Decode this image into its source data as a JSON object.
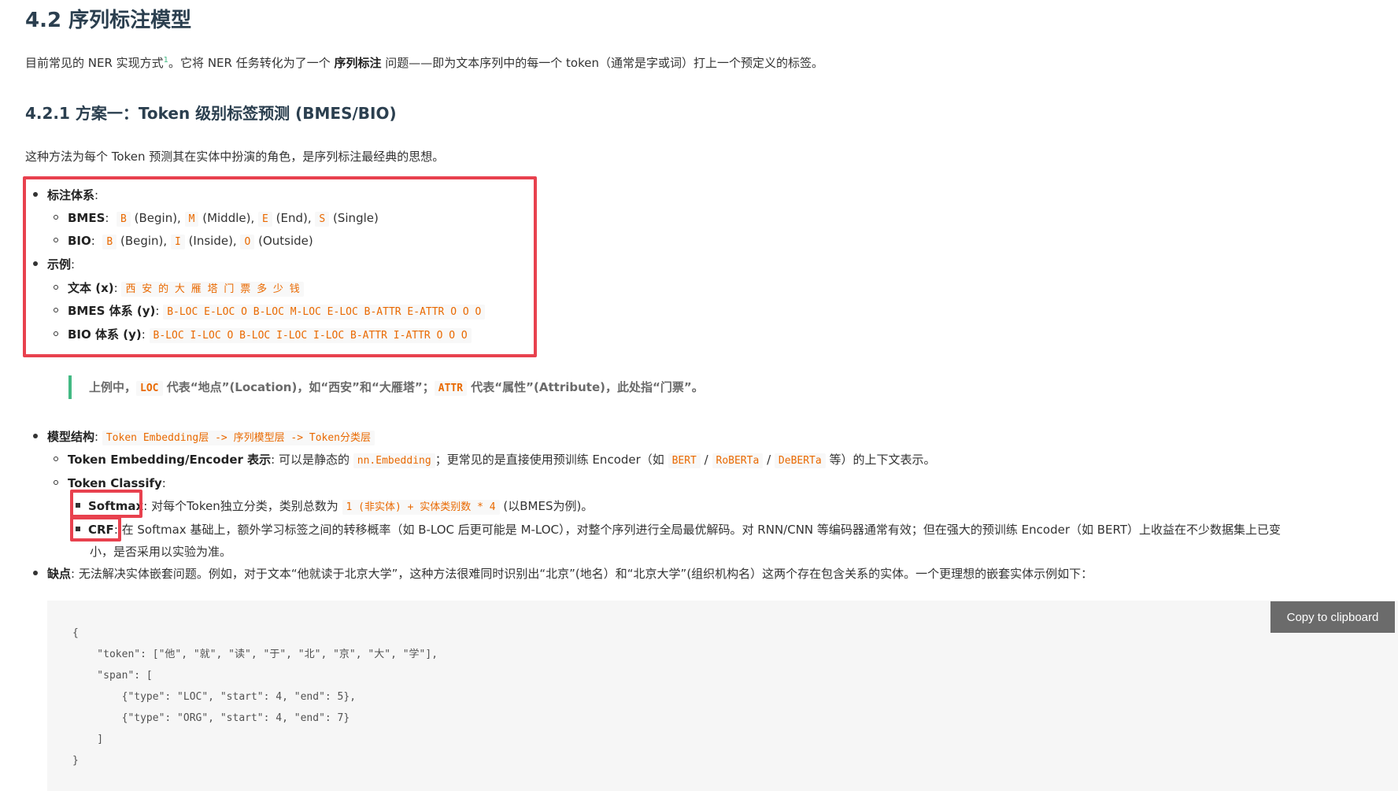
{
  "heading": "4.2 序列标注模型",
  "intro": {
    "pre": "目前常见的 NER 实现方式",
    "sup": "1",
    "mid": "。它将 NER 任务转化为了一个 ",
    "bold": "序列标注",
    "post": " 问题——即为文本序列中的每一个 token（通常是字或词）打上一个预定义的标签。"
  },
  "subheading": "4.2.1 方案一：Token 级别标签预测 (BMES/BIO)",
  "method_desc": "这种方法为每个 Token 预测其在实体中扮演的角色，是序列标注最经典的思想。",
  "annotation": {
    "title": "标注体系",
    "colon": ":",
    "bmes_label": "BMES",
    "bmes_items": [
      {
        "code": "B",
        "text": "(Begin),"
      },
      {
        "code": "M",
        "text": "(Middle),"
      },
      {
        "code": "E",
        "text": "(End),"
      },
      {
        "code": "S",
        "text": "(Single)"
      }
    ],
    "bio_label": "BIO",
    "bio_items": [
      {
        "code": "B",
        "text": "(Begin),"
      },
      {
        "code": "I",
        "text": "(Inside),"
      },
      {
        "code": "O",
        "text": "(Outside)"
      }
    ]
  },
  "example": {
    "title": "示例",
    "text_label": "文本 (x)",
    "text_value": "西 安 的 大 雁 塔 门 票 多 少 钱",
    "bmes_label": "BMES 体系 (y)",
    "bmes_value": "B-LOC E-LOC O B-LOC M-LOC E-LOC B-ATTR E-ATTR O O O",
    "bio_label": "BIO 体系 (y)",
    "bio_value": "B-LOC I-LOC O B-LOC I-LOC I-LOC B-ATTR I-ATTR O O O"
  },
  "note": {
    "t1": "上例中，",
    "c1": "LOC",
    "t2": " 代表“地点”(Location)，如“西安”和“大雁塔”；",
    "c2": "ATTR",
    "t3": " 代表“属性”(Attribute)，此处指“门票”。"
  },
  "model": {
    "title": "模型结构",
    "structure_code": "Token Embedding层 -> 序列模型层 -> Token分类层",
    "embedding_label": "Token Embedding/Encoder 表示",
    "embedding_t1": " 可以是静态的 ",
    "embedding_code1": "nn.Embedding",
    "embedding_t2": "；更常见的是直接使用预训练 Encoder（如 ",
    "embedding_code2": "BERT",
    "slash": "/",
    "embedding_code3": "RoBERTa",
    "embedding_code4": "DeBERTa",
    "embedding_t3": " 等）的上下文表示。",
    "classify_label": "Token Classify",
    "softmax_label": "Softmax",
    "softmax_t1": " 对每个Token独立分类，类别总数为 ",
    "softmax_code": "1 (非实体) + 实体类别数 * 4",
    "softmax_t2": " (以BMES为例)。",
    "crf_label": "CRF",
    "crf_line1": " 在 Softmax 基础上，额外学习标签之间的转移概率（如 B-LOC 后更可能是 M-LOC），对整个序列进行全局最优解码。对 RNN/CNN 等编码器通常有效；但在强大的预训练 Encoder（如 BERT）上收益在不少数据集上已变",
    "crf_line2": "小，是否采用以实验为准。"
  },
  "drawback": {
    "title": "缺点",
    "text": " 无法解决实体嵌套问题。例如，对于文本“他就读于北京大学”，这种方法很难同时识别出“北京”(地名）和“北京大学”(组织机构名）这两个存在包含关系的实体。一个更理想的嵌套实体示例如下："
  },
  "code_lines": [
    "{",
    "    \"token\": [\"他\", \"就\", \"读\", \"于\", \"北\", \"京\", \"大\", \"学\"],",
    "    \"span\": [",
    "        {\"type\": \"LOC\", \"start\": 4, \"end\": 5},",
    "        {\"type\": \"ORG\", \"start\": 4, \"end\": 7}",
    "    ]",
    "}"
  ],
  "copy_button": "Copy to clipboard",
  "colors": {
    "accent_red": "#e8414e",
    "code_orange": "#e96900",
    "quote_green": "#42b983"
  }
}
